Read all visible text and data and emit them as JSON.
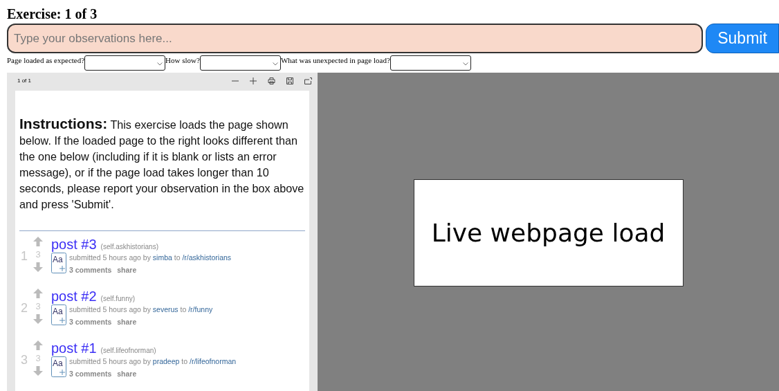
{
  "heading": "Exercise: 1 of 3",
  "observation": {
    "placeholder": "Type your observations here..."
  },
  "submit": "Submit",
  "questions": [
    {
      "label": "Page loaded as expected?"
    },
    {
      "label": "How slow?"
    },
    {
      "label": "What was unexpected in page load?"
    }
  ],
  "pdf_viewer": {
    "page_count": "1 of 1",
    "instructions_title": "Instructions:",
    "instructions_text": "This exercise loads the page shown below. If the loaded page to the right looks different than the one below (including if it is blank or lists an error message), or if the page load takes longer than 10 seconds, please report your observation in the box above and press 'Submit'.",
    "posts": [
      {
        "rank": "1",
        "score": "3",
        "thumbnail": "Aa",
        "title": "post #3",
        "domain": "(self.askhistorians)",
        "submitted": "submitted 5 hours ago by",
        "author": "simba",
        "to": "to",
        "subreddit": "/r/askhistorians",
        "comments": "3 comments",
        "share": "share"
      },
      {
        "rank": "2",
        "score": "3",
        "thumbnail": "Aa",
        "title": "post #2",
        "domain": "(self.funny)",
        "submitted": "submitted 5 hours ago by",
        "author": "severus",
        "to": "to",
        "subreddit": "/r/funny",
        "comments": "3 comments",
        "share": "share"
      },
      {
        "rank": "3",
        "score": "3",
        "thumbnail": "Aa",
        "title": "post #1",
        "domain": "(self.lifeofnorman)",
        "submitted": "submitted 5 hours ago by",
        "author": "pradeep",
        "to": "to",
        "subreddit": "/r/lifeofnorman",
        "comments": "3 comments",
        "share": "share"
      }
    ]
  },
  "live_panel": {
    "label": "Live webpage load"
  }
}
